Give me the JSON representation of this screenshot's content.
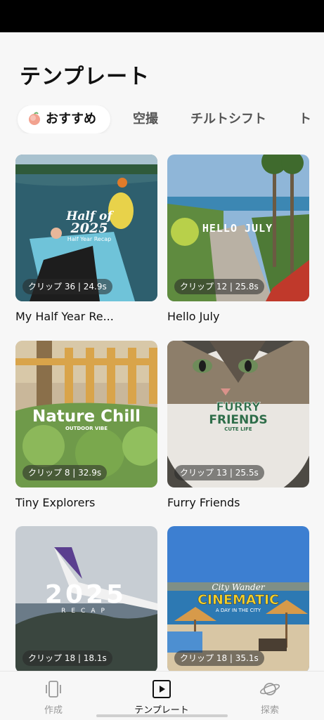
{
  "header": {
    "title": "テンプレート"
  },
  "tabs": [
    {
      "label": "おすすめ",
      "icon": "peach-icon",
      "active": true
    },
    {
      "label": "空撮",
      "active": false
    },
    {
      "label": "チルトシフト",
      "active": false
    },
    {
      "label": "ト",
      "active": false
    }
  ],
  "templates": [
    {
      "title": "My Half Year Re...",
      "clip": "クリップ 36 | 24.9s",
      "overlay_line1": "Half of",
      "overlay_line2": "2025",
      "overlay_line3": "Half Year Recap"
    },
    {
      "title": "Hello July",
      "clip": "クリップ 12 | 25.8s",
      "overlay_line1": "HELLO JULY"
    },
    {
      "title": "Tiny Explorers",
      "clip": "クリップ 8 | 32.9s",
      "overlay_line1": "Nature Chill",
      "overlay_line2": "OUTDOOR VIBE"
    },
    {
      "title": "Furry Friends",
      "clip": "クリップ 13 | 25.5s",
      "overlay_line1": "FURRY",
      "overlay_line2": "FRIENDS",
      "overlay_line3": "CUTE LIFE"
    },
    {
      "title": "",
      "clip": "クリップ 18 | 18.1s",
      "overlay_line1": "2025",
      "overlay_line2": "RECAP"
    },
    {
      "title": "",
      "clip": "クリップ 18 | 35.1s",
      "overlay_line1": "City Wander",
      "overlay_line2": "CINEMATIC",
      "overlay_line3": "A DAY IN THE CITY"
    }
  ],
  "nav": [
    {
      "label": "作成",
      "icon": "phone-vibrate-icon",
      "active": false
    },
    {
      "label": "テンプレート",
      "icon": "play-square-icon",
      "active": true
    },
    {
      "label": "探索",
      "icon": "planet-icon",
      "active": false
    }
  ],
  "colors": {
    "accent": "#111111",
    "inactive": "#999999",
    "background": "#f7f7f7"
  }
}
